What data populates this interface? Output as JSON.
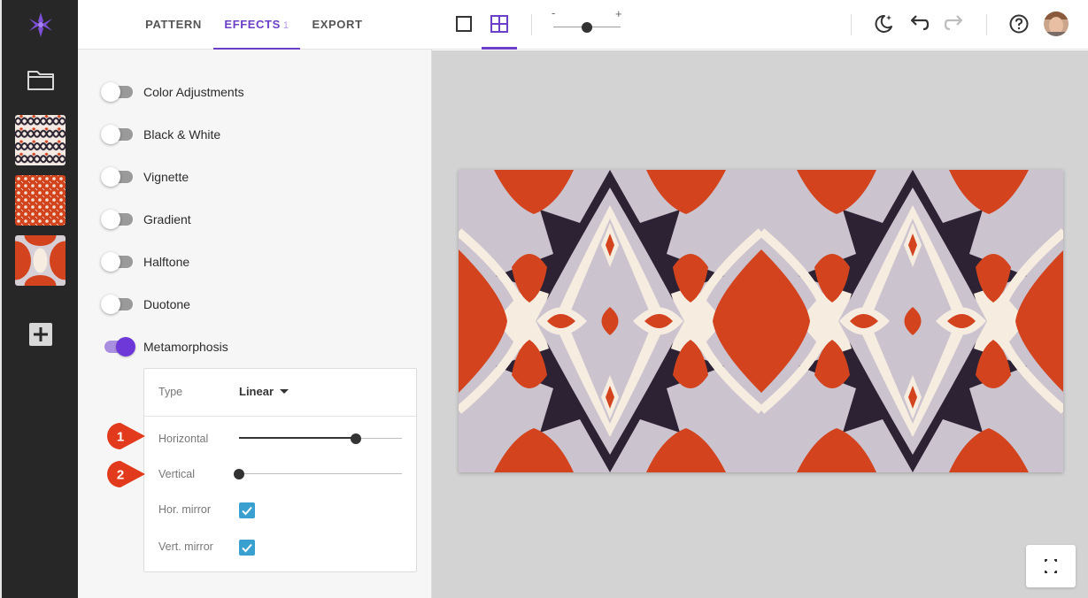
{
  "rail": {
    "logo_icon": "flower-logo-icon",
    "folder_icon": "folder-icon",
    "add_icon": "plus-square-icon",
    "thumbnails": [
      "pattern-thumbnail-1",
      "pattern-thumbnail-2",
      "pattern-thumbnail-3"
    ]
  },
  "tabs": [
    {
      "label": "PATTERN",
      "active": false
    },
    {
      "label": "EFFECTS",
      "count": "1",
      "active": true
    },
    {
      "label": "EXPORT",
      "active": false
    }
  ],
  "effects": [
    {
      "label": "Color Adjustments",
      "enabled": false
    },
    {
      "label": "Black & White",
      "enabled": false
    },
    {
      "label": "Vignette",
      "enabled": false
    },
    {
      "label": "Gradient",
      "enabled": false
    },
    {
      "label": "Halftone",
      "enabled": false
    },
    {
      "label": "Duotone",
      "enabled": false
    },
    {
      "label": "Metamorphosis",
      "enabled": true
    }
  ],
  "metamorphosis": {
    "type_label": "Type",
    "type_value": "Linear",
    "horizontal_label": "Horizontal",
    "horizontal_value": 0.72,
    "vertical_label": "Vertical",
    "vertical_value": 0.0,
    "hor_mirror_label": "Hor. mirror",
    "hor_mirror_checked": true,
    "vert_mirror_label": "Vert. mirror",
    "vert_mirror_checked": true
  },
  "markers": [
    "1",
    "2"
  ],
  "toolbar": {
    "icons": [
      "single-view-icon",
      "tiled-view-icon",
      "night-mode-icon",
      "undo-icon",
      "redo-icon",
      "help-icon"
    ],
    "zoom_minus": "-",
    "zoom_plus": "+",
    "zoom_value": 0.5
  },
  "colors": {
    "accent": "#6b3fc7",
    "pattern_red": "#d2431e",
    "pattern_cream": "#f6ede0",
    "pattern_lilac": "#c9c3cd",
    "pattern_dark": "#2c2233",
    "checkbox": "#3aa0cf",
    "marker": "#e23a1c"
  }
}
